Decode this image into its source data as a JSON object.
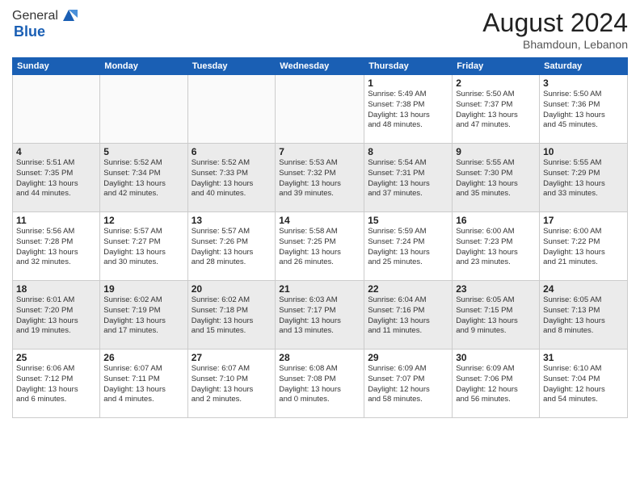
{
  "header": {
    "logo_general": "General",
    "logo_blue": "Blue",
    "month_year": "August 2024",
    "location": "Bhamdoun, Lebanon"
  },
  "weekdays": [
    "Sunday",
    "Monday",
    "Tuesday",
    "Wednesday",
    "Thursday",
    "Friday",
    "Saturday"
  ],
  "weeks": [
    [
      {
        "day": "",
        "info": ""
      },
      {
        "day": "",
        "info": ""
      },
      {
        "day": "",
        "info": ""
      },
      {
        "day": "",
        "info": ""
      },
      {
        "day": "1",
        "info": "Sunrise: 5:49 AM\nSunset: 7:38 PM\nDaylight: 13 hours\nand 48 minutes."
      },
      {
        "day": "2",
        "info": "Sunrise: 5:50 AM\nSunset: 7:37 PM\nDaylight: 13 hours\nand 47 minutes."
      },
      {
        "day": "3",
        "info": "Sunrise: 5:50 AM\nSunset: 7:36 PM\nDaylight: 13 hours\nand 45 minutes."
      }
    ],
    [
      {
        "day": "4",
        "info": "Sunrise: 5:51 AM\nSunset: 7:35 PM\nDaylight: 13 hours\nand 44 minutes."
      },
      {
        "day": "5",
        "info": "Sunrise: 5:52 AM\nSunset: 7:34 PM\nDaylight: 13 hours\nand 42 minutes."
      },
      {
        "day": "6",
        "info": "Sunrise: 5:52 AM\nSunset: 7:33 PM\nDaylight: 13 hours\nand 40 minutes."
      },
      {
        "day": "7",
        "info": "Sunrise: 5:53 AM\nSunset: 7:32 PM\nDaylight: 13 hours\nand 39 minutes."
      },
      {
        "day": "8",
        "info": "Sunrise: 5:54 AM\nSunset: 7:31 PM\nDaylight: 13 hours\nand 37 minutes."
      },
      {
        "day": "9",
        "info": "Sunrise: 5:55 AM\nSunset: 7:30 PM\nDaylight: 13 hours\nand 35 minutes."
      },
      {
        "day": "10",
        "info": "Sunrise: 5:55 AM\nSunset: 7:29 PM\nDaylight: 13 hours\nand 33 minutes."
      }
    ],
    [
      {
        "day": "11",
        "info": "Sunrise: 5:56 AM\nSunset: 7:28 PM\nDaylight: 13 hours\nand 32 minutes."
      },
      {
        "day": "12",
        "info": "Sunrise: 5:57 AM\nSunset: 7:27 PM\nDaylight: 13 hours\nand 30 minutes."
      },
      {
        "day": "13",
        "info": "Sunrise: 5:57 AM\nSunset: 7:26 PM\nDaylight: 13 hours\nand 28 minutes."
      },
      {
        "day": "14",
        "info": "Sunrise: 5:58 AM\nSunset: 7:25 PM\nDaylight: 13 hours\nand 26 minutes."
      },
      {
        "day": "15",
        "info": "Sunrise: 5:59 AM\nSunset: 7:24 PM\nDaylight: 13 hours\nand 25 minutes."
      },
      {
        "day": "16",
        "info": "Sunrise: 6:00 AM\nSunset: 7:23 PM\nDaylight: 13 hours\nand 23 minutes."
      },
      {
        "day": "17",
        "info": "Sunrise: 6:00 AM\nSunset: 7:22 PM\nDaylight: 13 hours\nand 21 minutes."
      }
    ],
    [
      {
        "day": "18",
        "info": "Sunrise: 6:01 AM\nSunset: 7:20 PM\nDaylight: 13 hours\nand 19 minutes."
      },
      {
        "day": "19",
        "info": "Sunrise: 6:02 AM\nSunset: 7:19 PM\nDaylight: 13 hours\nand 17 minutes."
      },
      {
        "day": "20",
        "info": "Sunrise: 6:02 AM\nSunset: 7:18 PM\nDaylight: 13 hours\nand 15 minutes."
      },
      {
        "day": "21",
        "info": "Sunrise: 6:03 AM\nSunset: 7:17 PM\nDaylight: 13 hours\nand 13 minutes."
      },
      {
        "day": "22",
        "info": "Sunrise: 6:04 AM\nSunset: 7:16 PM\nDaylight: 13 hours\nand 11 minutes."
      },
      {
        "day": "23",
        "info": "Sunrise: 6:05 AM\nSunset: 7:15 PM\nDaylight: 13 hours\nand 9 minutes."
      },
      {
        "day": "24",
        "info": "Sunrise: 6:05 AM\nSunset: 7:13 PM\nDaylight: 13 hours\nand 8 minutes."
      }
    ],
    [
      {
        "day": "25",
        "info": "Sunrise: 6:06 AM\nSunset: 7:12 PM\nDaylight: 13 hours\nand 6 minutes."
      },
      {
        "day": "26",
        "info": "Sunrise: 6:07 AM\nSunset: 7:11 PM\nDaylight: 13 hours\nand 4 minutes."
      },
      {
        "day": "27",
        "info": "Sunrise: 6:07 AM\nSunset: 7:10 PM\nDaylight: 13 hours\nand 2 minutes."
      },
      {
        "day": "28",
        "info": "Sunrise: 6:08 AM\nSunset: 7:08 PM\nDaylight: 13 hours\nand 0 minutes."
      },
      {
        "day": "29",
        "info": "Sunrise: 6:09 AM\nSunset: 7:07 PM\nDaylight: 12 hours\nand 58 minutes."
      },
      {
        "day": "30",
        "info": "Sunrise: 6:09 AM\nSunset: 7:06 PM\nDaylight: 12 hours\nand 56 minutes."
      },
      {
        "day": "31",
        "info": "Sunrise: 6:10 AM\nSunset: 7:04 PM\nDaylight: 12 hours\nand 54 minutes."
      }
    ]
  ]
}
